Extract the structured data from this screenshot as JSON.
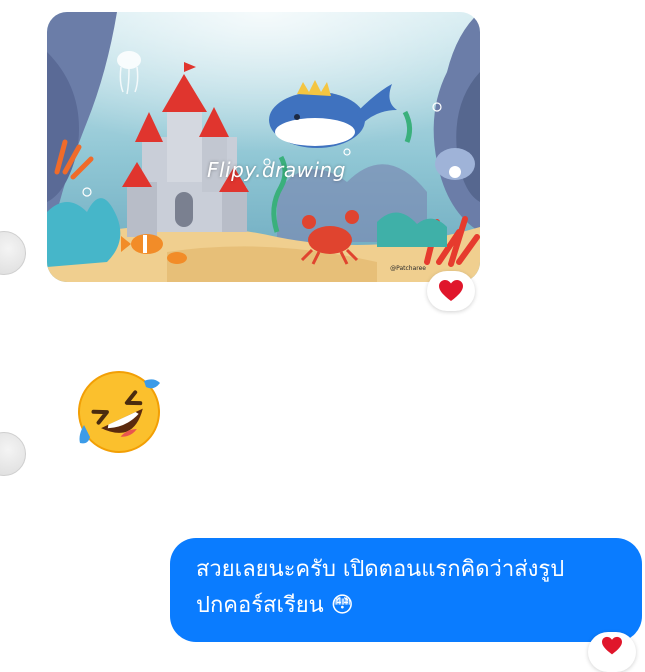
{
  "thread": {
    "image_message": {
      "watermark": "Flipy.drawing",
      "credit": "@Patcharee",
      "reaction_icon": "heart-icon"
    },
    "emoji_message": {
      "icon": "rolling-on-floor-laughing-emoji"
    },
    "outgoing_message": {
      "line1": "สวยเลยนะครับ เปิดตอนแรกคิดว่าส่งรูป",
      "line2": "ปกคอร์สเรียน 😳",
      "reaction_icon": "heart-icon"
    }
  },
  "colors": {
    "outgoing_bubble": "#0a7cff",
    "reaction_heart": "#e0162b"
  }
}
